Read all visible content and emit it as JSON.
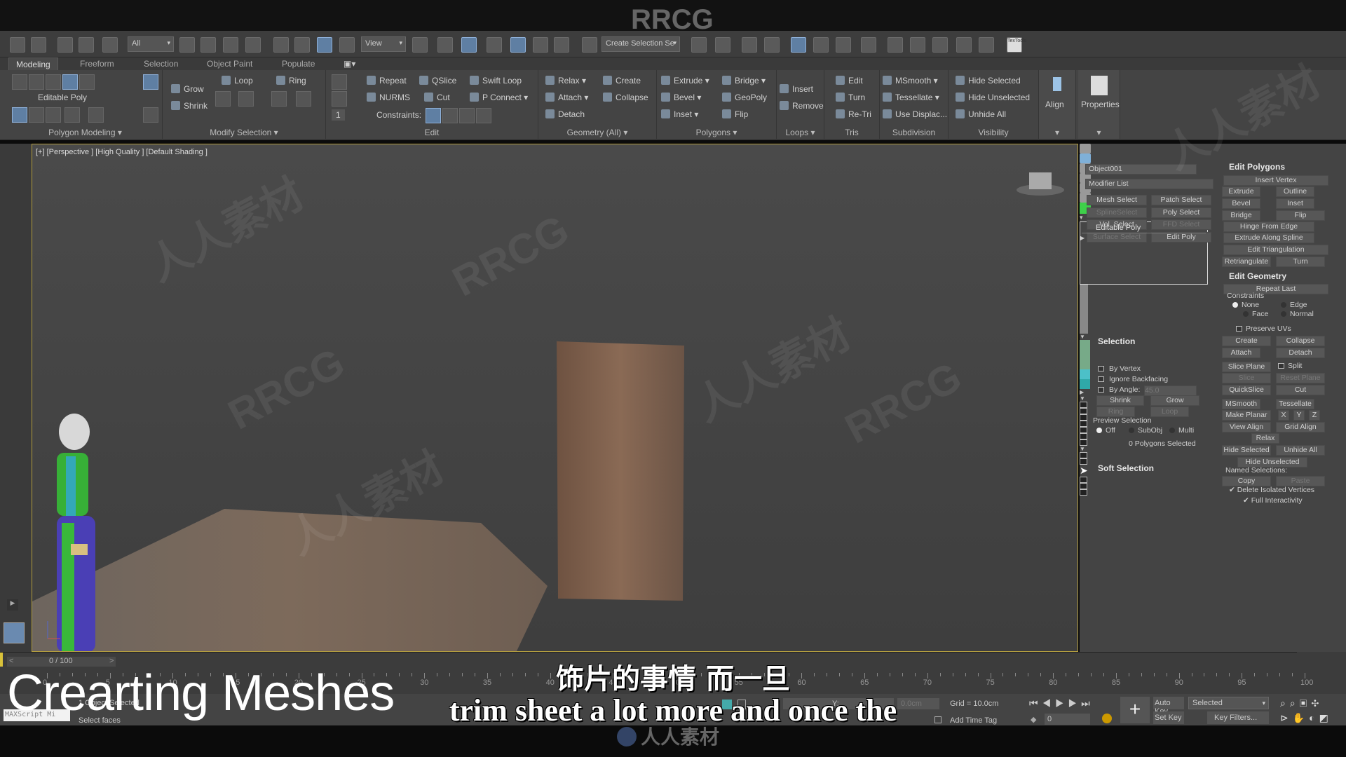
{
  "watermarks": {
    "top": "RRCG",
    "brand": "RRCG",
    "cn": "人人素材",
    "footer": "人人素材"
  },
  "toolbar": {
    "selection_filter": "All",
    "reference_coord": "View",
    "named_selection": "Create Selection Se",
    "textools_label": "TexTools"
  },
  "ribbon_tabs": [
    {
      "label": "Modeling",
      "active": true
    },
    {
      "label": "Freeform"
    },
    {
      "label": "Selection"
    },
    {
      "label": "Object Paint"
    },
    {
      "label": "Populate"
    }
  ],
  "ribbon": {
    "polygon_modeling": {
      "label": "Polygon Modeling ▾",
      "editable_poly": "Editable Poly"
    },
    "modify_selection": {
      "label": "Modify Selection ▾",
      "grow": "Grow",
      "shrink": "Shrink",
      "loop": "Loop",
      "ring": "Ring"
    },
    "edit": {
      "label": "Edit",
      "repeat": "Repeat",
      "qslice": "QSlice",
      "swift_loop": "Swift Loop",
      "nurms": "NURMS",
      "cut": "Cut",
      "p_connect": "P Connect ▾",
      "constraints": "Constraints:",
      "spinner": "1"
    },
    "geometry": {
      "label": "Geometry (All) ▾",
      "relax": "Relax ▾",
      "create": "Create",
      "attach": "Attach ▾",
      "collapse": "Collapse",
      "detach": "Detach"
    },
    "polygons": {
      "label": "Polygons ▾",
      "extrude": "Extrude ▾",
      "bridge": "Bridge ▾",
      "bevel": "Bevel ▾",
      "geopoly": "GeoPoly",
      "inset": "Inset ▾",
      "flip": "Flip"
    },
    "loops": {
      "label": "Loops ▾",
      "insert": "Insert",
      "remove": "Remove"
    },
    "tris": {
      "label": "Tris",
      "edit": "Edit",
      "turn": "Turn",
      "retri": "Re-Tri"
    },
    "subdivision": {
      "label": "Subdivision",
      "msmooth": "MSmooth ▾",
      "tessellate": "Tessellate ▾",
      "use_displace": "Use Displac..."
    },
    "visibility": {
      "label": "Visibility",
      "hide_selected": "Hide Selected",
      "hide_unselected": "Hide Unselected",
      "unhide_all": "Unhide All"
    },
    "align": "Align",
    "properties": "Properties"
  },
  "viewport": {
    "label": "[+] [Perspective ] [High Quality ] [Default Shading ]"
  },
  "command_panel": {
    "object_name": "Object001",
    "object_color": "#3ed14a",
    "modifier_list": "Modifier List",
    "modifier_buttons": [
      {
        "label": "Mesh Select",
        "enabled": true
      },
      {
        "label": "Patch Select",
        "enabled": true
      },
      {
        "label": "SplineSelect",
        "enabled": false
      },
      {
        "label": "Poly Select",
        "enabled": true
      },
      {
        "label": "Vol. Select",
        "enabled": true
      },
      {
        "label": "FFD Select",
        "enabled": false
      },
      {
        "label": "Surface Select",
        "enabled": false
      },
      {
        "label": "Edit Poly",
        "enabled": true
      }
    ],
    "stack": [
      "Editable Poly"
    ],
    "selection": {
      "title": "Selection",
      "by_vertex": "By Vertex",
      "ignore_backfacing": "Ignore Backfacing",
      "by_angle": "By Angle:",
      "angle_value": "45.0",
      "shrink": "Shrink",
      "grow": "Grow",
      "ring": "Ring",
      "loop": "Loop",
      "preview_selection": "Preview Selection",
      "preview_options": [
        "Off",
        "SubObj",
        "Multi"
      ],
      "preview_selected": "Off",
      "status": "0 Polygons Selected"
    },
    "soft_selection": "Soft Selection",
    "edit_polygons": {
      "title": "Edit Polygons",
      "insert_vertex": "Insert Vertex",
      "extrude": "Extrude",
      "outline": "Outline",
      "bevel": "Bevel",
      "inset": "Inset",
      "bridge": "Bridge",
      "flip": "Flip",
      "hinge": "Hinge From Edge",
      "extrude_spline": "Extrude Along Spline",
      "edit_tri": "Edit Triangulation",
      "retriangulate": "Retriangulate",
      "turn": "Turn"
    },
    "edit_geometry": {
      "title": "Edit Geometry",
      "repeat_last": "Repeat Last",
      "constraints": "Constraints",
      "none": "None",
      "edge": "Edge",
      "face": "Face",
      "normal": "Normal",
      "preserve_uvs": "Preserve UVs",
      "create": "Create",
      "collapse": "Collapse",
      "attach": "Attach",
      "detach": "Detach",
      "slice_plane": "Slice Plane",
      "split": "Split",
      "slice": "Slice",
      "reset_plane": "Reset Plane",
      "quickslice": "QuickSlice",
      "cut": "Cut",
      "msmooth": "MSmooth",
      "tessellate": "Tessellate",
      "make_planar": "Make Planar",
      "x": "X",
      "y": "Y",
      "z": "Z",
      "view_align": "View Align",
      "grid_align": "Grid Align",
      "relax": "Relax",
      "hide_selected": "Hide Selected",
      "unhide_all": "Unhide All",
      "hide_unselected": "Hide Unselected",
      "named_selections": "Named Selections:",
      "copy": "Copy",
      "paste": "Paste",
      "delete_isolated": "Delete Isolated Vertices",
      "full_interactivity": "Full Interactivity"
    }
  },
  "timeline": {
    "frame": "0 / 100",
    "ticks": [
      "0",
      "5",
      "10",
      "15",
      "20",
      "25",
      "30",
      "35",
      "40",
      "45",
      "50",
      "55",
      "60",
      "65",
      "70",
      "75",
      "80",
      "85",
      "90",
      "95",
      "100"
    ]
  },
  "status": {
    "objects": "1 Object Selected",
    "prompt": "Select faces",
    "maxscript": "MAXScript Mi",
    "x_label": "X:",
    "y_label": "Y:",
    "z_value": "0.0cm",
    "grid": "Grid = 10.0cm",
    "add_time_tag": "Add Time Tag",
    "current_frame": "0",
    "auto_key": "Auto Key",
    "set_key": "Set Key",
    "key_mode": "Selected",
    "key_filters": "Key Filters..."
  },
  "overlay": {
    "title": "Crearting Meshes",
    "subtitle_cn": "饰片的事情 而一旦",
    "subtitle_en": "trim sheet a lot more and once the"
  }
}
